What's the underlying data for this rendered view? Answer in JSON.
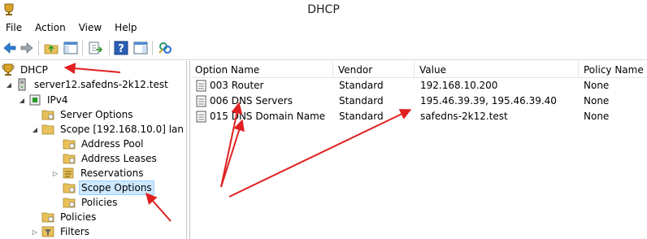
{
  "window": {
    "title": "DHCP"
  },
  "menu": [
    "File",
    "Action",
    "View",
    "Help"
  ],
  "toolbar": {
    "buttons": [
      "back-icon",
      "forward-icon",
      "up-folder-icon",
      "show-hide-console-tree-icon",
      "export-list-icon",
      "help-icon",
      "show-hide-action-pane-icon",
      "refresh-server-icon"
    ]
  },
  "tree": {
    "root": "DHCP",
    "server": "server12.safedns-2k12.test",
    "ipv4": "IPv4",
    "server_options": "Server Options",
    "scope": "Scope [192.168.10.0] lan",
    "address_pool": "Address Pool",
    "address_leases": "Address Leases",
    "reservations": "Reservations",
    "scope_options": "Scope Options",
    "scope_policies": "Policies",
    "policies": "Policies",
    "filters": "Filters"
  },
  "table": {
    "headers": [
      "Option Name",
      "Vendor",
      "Value",
      "Policy Name"
    ],
    "rows": [
      [
        "003 Router",
        "Standard",
        "192.168.10.200",
        "None"
      ],
      [
        "006 DNS Servers",
        "Standard",
        "195.46.39.39, 195.46.39.40",
        "None"
      ],
      [
        "015 DNS Domain Name",
        "Standard",
        "safedns-2k12.test",
        "None"
      ]
    ]
  },
  "colors": {
    "annotation_arrow": "#e02020",
    "selection": "#cde8ff",
    "folder": "#e8c15a"
  }
}
